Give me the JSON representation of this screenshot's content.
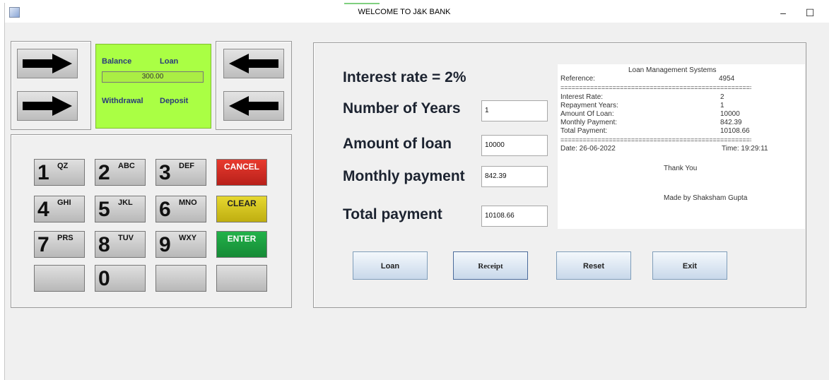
{
  "window": {
    "title": "WELCOME TO J&K BANK",
    "minimize": "–",
    "maximize": "☐"
  },
  "atm": {
    "screen": {
      "balance": "Balance",
      "loan": "Loan",
      "balance_value": "300.00",
      "withdrawal": "Withdrawal",
      "deposit": "Deposit"
    },
    "keys": [
      {
        "num": "1",
        "sup": "QZ"
      },
      {
        "num": "2",
        "sup": "ABC"
      },
      {
        "num": "3",
        "sup": "DEF"
      },
      {
        "num": "4",
        "sup": "GHI"
      },
      {
        "num": "5",
        "sup": "JKL"
      },
      {
        "num": "6",
        "sup": "MNO"
      },
      {
        "num": "7",
        "sup": "PRS"
      },
      {
        "num": "8",
        "sup": "TUV"
      },
      {
        "num": "9",
        "sup": "WXY"
      },
      {
        "num": "0",
        "sup": ""
      }
    ],
    "fn": {
      "cancel": "CANCEL",
      "clear": "CLEAR",
      "enter": "ENTER"
    },
    "colors": {
      "screen": "#aaff44",
      "cancel": "#d22a22",
      "clear": "#d6c820",
      "enter": "#1aa040"
    }
  },
  "loan_form": {
    "interest_label": "Interest rate  =  2%",
    "years_label": "Number of Years",
    "years_value": "1",
    "amount_label": "Amount of loan",
    "amount_value": "10000",
    "monthly_label": "Monthly payment",
    "monthly_value": "842.39",
    "total_label": "Total payment",
    "total_value": "10108.66"
  },
  "receipt": {
    "title": "Loan Management Systems",
    "reference_label": "Reference:",
    "reference_value": "4954",
    "separator": "==========================================================",
    "rows": [
      {
        "label": "Interest Rate:",
        "value": "2"
      },
      {
        "label": "Repayment Years:",
        "value": "1"
      },
      {
        "label": "Amount Of Loan:",
        "value": " 10000"
      },
      {
        "label": "Monthly Payment:",
        "value": "842.39"
      },
      {
        "label": "Total Payment:",
        "value": "10108.66"
      }
    ],
    "date": "Date: 26-06-2022",
    "time": "Time: 19:29:11",
    "thanks": "Thank You",
    "credit": "Made by Shaksham Gupta"
  },
  "actions": {
    "loan": "Loan",
    "receipt": "Receipt",
    "reset": "Reset",
    "exit": "Exit"
  }
}
